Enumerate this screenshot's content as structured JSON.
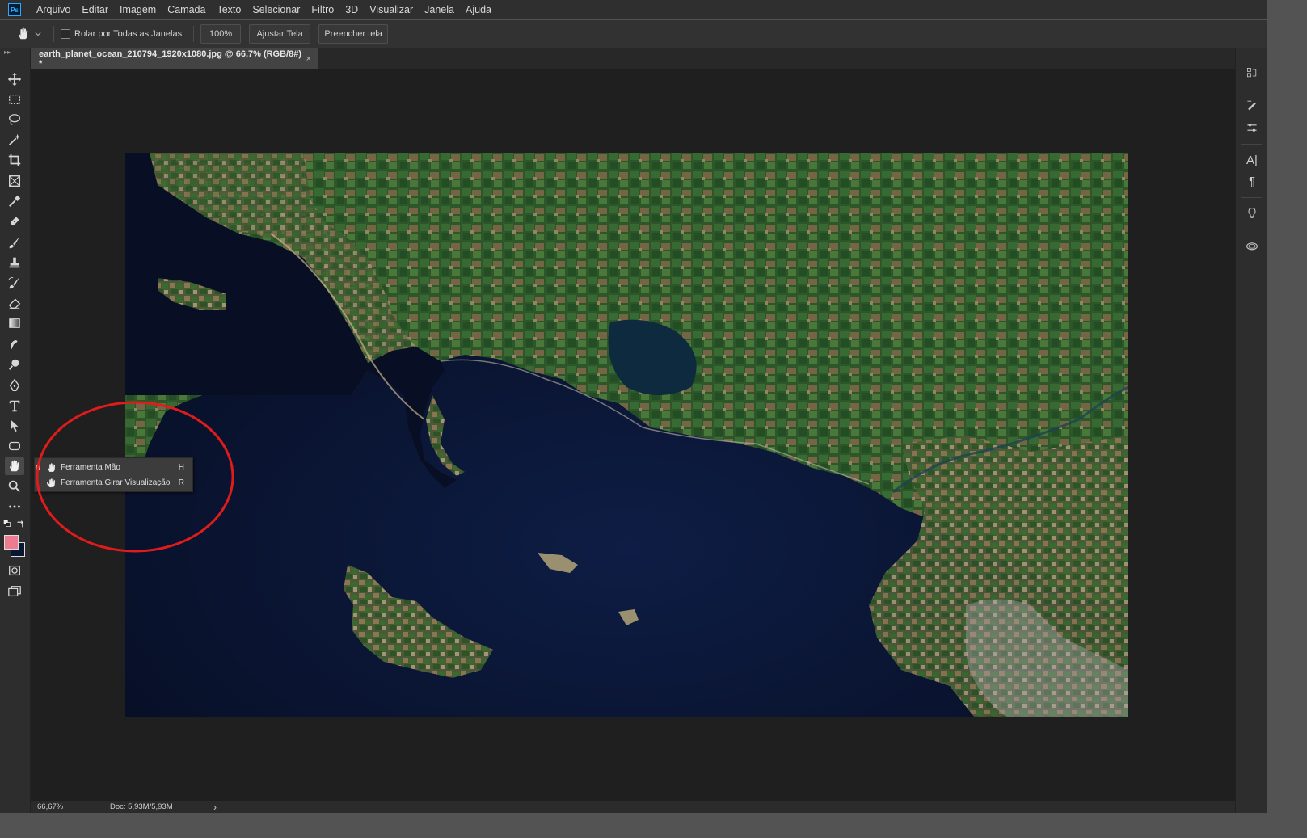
{
  "app": {
    "logo_text": "Ps"
  },
  "menu": [
    "Arquivo",
    "Editar",
    "Imagem",
    "Camada",
    "Texto",
    "Selecionar",
    "Filtro",
    "3D",
    "Visualizar",
    "Janela",
    "Ajuda"
  ],
  "options": {
    "scroll_all_windows": "Rolar por Todas as Janelas",
    "zoom_value": "100%",
    "fit_screen": "Ajustar Tela",
    "fill_screen": "Preencher tela"
  },
  "document_tab": {
    "title": "earth_planet_ocean_210794_1920x1080.jpg @ 66,7% (RGB/8#) *",
    "close": "×"
  },
  "flyout": {
    "items": [
      {
        "label": "Ferramenta Mão",
        "shortcut": "H",
        "selected": true
      },
      {
        "label": "Ferramenta Girar Visualização",
        "shortcut": "R",
        "selected": false
      }
    ]
  },
  "status": {
    "zoom": "66,67%",
    "doc": "Doc: 5,93M/5,93M",
    "arrow": "›"
  },
  "colors": {
    "foreground": "#ee7c90",
    "background": "#0a1733",
    "annotation_ring": "#e01b1b"
  },
  "tools": [
    "move-icon",
    "marquee-icon",
    "lasso-icon",
    "magic-wand-icon",
    "crop-icon",
    "frame-icon",
    "eyedropper-icon",
    "healing-brush-icon",
    "brush-icon",
    "clone-stamp-icon",
    "history-brush-icon",
    "eraser-icon",
    "gradient-icon",
    "smudge-icon",
    "dodge-icon",
    "pen-icon",
    "type-icon",
    "path-selection-icon",
    "shape-icon",
    "hand-icon",
    "zoom-icon",
    "more-tools-icon",
    "quick-mask-icon",
    "screen-mode-icon"
  ]
}
